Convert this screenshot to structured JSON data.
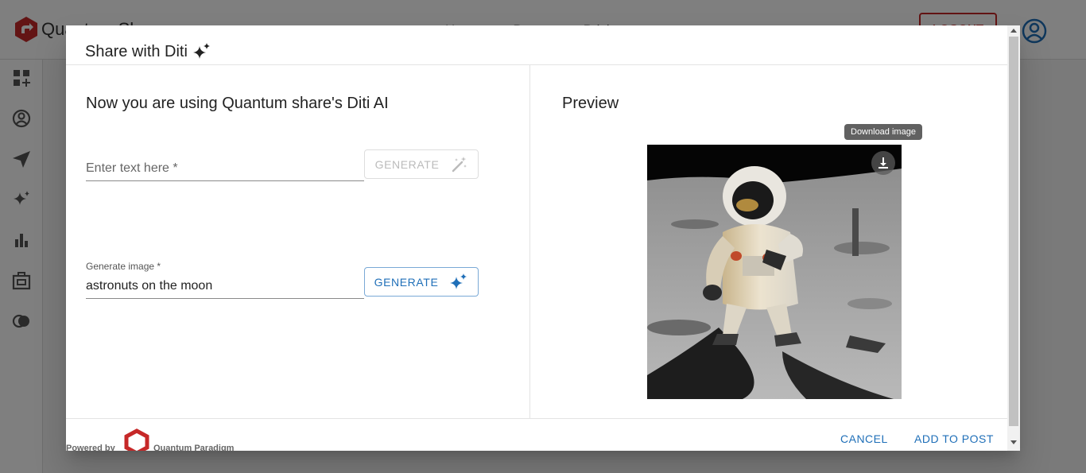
{
  "background": {
    "app_name": "Quantum Share",
    "nav": [
      "Home",
      "Pages",
      "Pricing"
    ],
    "logout_label": "LOGOUT",
    "sidebar_icons": [
      "dashboard-add-icon",
      "account-icon",
      "send-icon",
      "sparkle-icon",
      "bar-chart-icon",
      "work-icon",
      "circles-icon"
    ]
  },
  "dialog": {
    "title": "Share with Diti",
    "intro_text": "Now you are using Quantum share's Diti AI",
    "text_field": {
      "placeholder": "Enter text here *",
      "value": ""
    },
    "generate_text_button": "GENERATE",
    "image_field": {
      "label": "Generate image *",
      "value": "astronuts on the moon"
    },
    "generate_image_button": "GENERATE",
    "preview_title": "Preview",
    "download_tooltip": "Download image",
    "powered_by": "Powered by",
    "company_name": "Quantum Paradigm",
    "cancel_label": "CANCEL",
    "add_to_post_label": "ADD TO POST"
  },
  "colors": {
    "accent_blue": "#1f6fb8",
    "brand_red": "#c62828"
  }
}
